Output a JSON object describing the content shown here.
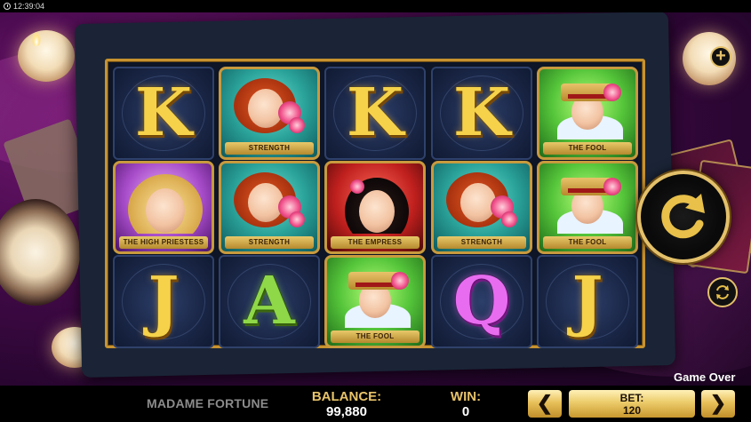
{
  "status_bar": {
    "time": "12:39:04"
  },
  "game": {
    "title": "MADAME FORTUNE",
    "status": "Game Over"
  },
  "reels": [
    [
      {
        "type": "letter",
        "symbol": "K",
        "color": "#f5d24a"
      },
      {
        "type": "tarot",
        "symbol": "THE HIGH PRIESTESS",
        "theme": "purple"
      },
      {
        "type": "letter",
        "symbol": "J",
        "color": "#f5d24a"
      }
    ],
    [
      {
        "type": "tarot",
        "symbol": "STRENGTH",
        "theme": "teal"
      },
      {
        "type": "tarot",
        "symbol": "STRENGTH",
        "theme": "teal"
      },
      {
        "type": "letter",
        "symbol": "A",
        "color": "#8fd848"
      }
    ],
    [
      {
        "type": "letter",
        "symbol": "K",
        "color": "#f5d24a"
      },
      {
        "type": "tarot",
        "symbol": "THE EMPRESS",
        "theme": "red"
      },
      {
        "type": "tarot",
        "symbol": "THE FOOL",
        "theme": "green"
      }
    ],
    [
      {
        "type": "letter",
        "symbol": "K",
        "color": "#f5d24a"
      },
      {
        "type": "tarot",
        "symbol": "STRENGTH",
        "theme": "teal"
      },
      {
        "type": "letter",
        "symbol": "Q",
        "color": "#e86cf0"
      }
    ],
    [
      {
        "type": "tarot",
        "symbol": "THE FOOL",
        "theme": "green"
      },
      {
        "type": "tarot",
        "symbol": "THE FOOL",
        "theme": "green"
      },
      {
        "type": "letter",
        "symbol": "J",
        "color": "#f5d24a"
      }
    ]
  ],
  "bottom_bar": {
    "balance_label": "BALANCE:",
    "balance_value": "99,880",
    "win_label": "WIN:",
    "win_value": "0",
    "bet_label": "BET:",
    "bet_value": "120",
    "prev_arrow": "❮",
    "next_arrow": "❯"
  },
  "icons": {
    "spin": "spin-arrow-icon",
    "autoplay": "autoplay-icon",
    "plus": "+"
  },
  "colors": {
    "gold": "#e3c06a",
    "frame": "#c7922f",
    "bar": "#000000"
  }
}
